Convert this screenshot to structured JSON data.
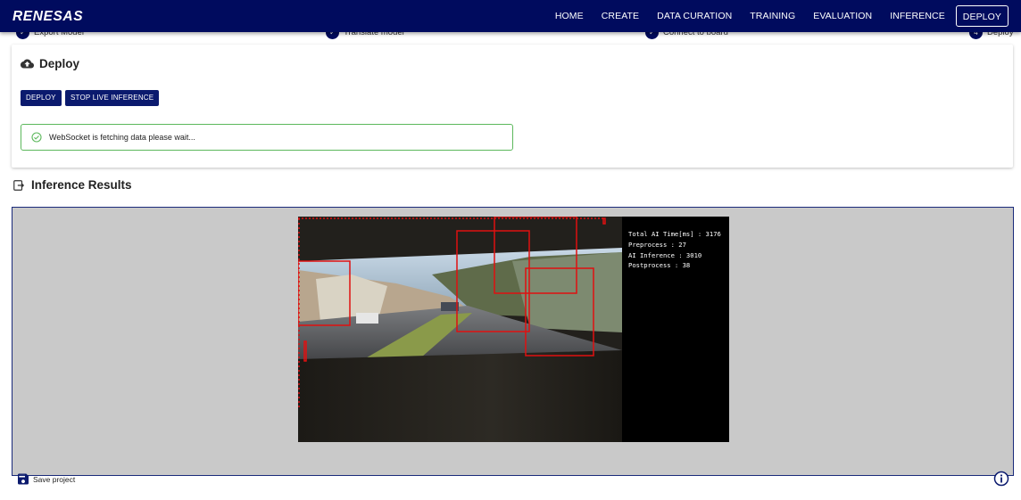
{
  "header": {
    "brand": "RENESAS",
    "nav": [
      "HOME",
      "CREATE",
      "DATA CURATION",
      "TRAINING",
      "EVALUATION",
      "INFERENCE"
    ],
    "nav_active": "DEPLOY"
  },
  "stepper": {
    "steps": [
      {
        "label": "Export Model",
        "state": "done"
      },
      {
        "label": "Translate model",
        "state": "done"
      },
      {
        "label": "Connect to board",
        "state": "done"
      },
      {
        "label": "Deploy",
        "state": "active",
        "number": "4"
      }
    ]
  },
  "deploy": {
    "title": "Deploy",
    "deploy_button": "DEPLOY",
    "stop_button": "STOP LIVE INFERENCE",
    "alert_message": "WebSocket is fetching data please wait..."
  },
  "inference": {
    "title": "Inference Results",
    "stats": [
      "Total AI Time[ms] : 3176",
      "Preprocess : 27",
      "AI Inference : 3010",
      "Postprocess : 38"
    ]
  },
  "footer": {
    "save_label": "Save project"
  },
  "colors": {
    "brand_navy": "#000b5e",
    "button": "#0b1a6e",
    "alert_border": "#5cb85c",
    "results_bg": "#c9c9c9",
    "bbox": "#e01010"
  }
}
